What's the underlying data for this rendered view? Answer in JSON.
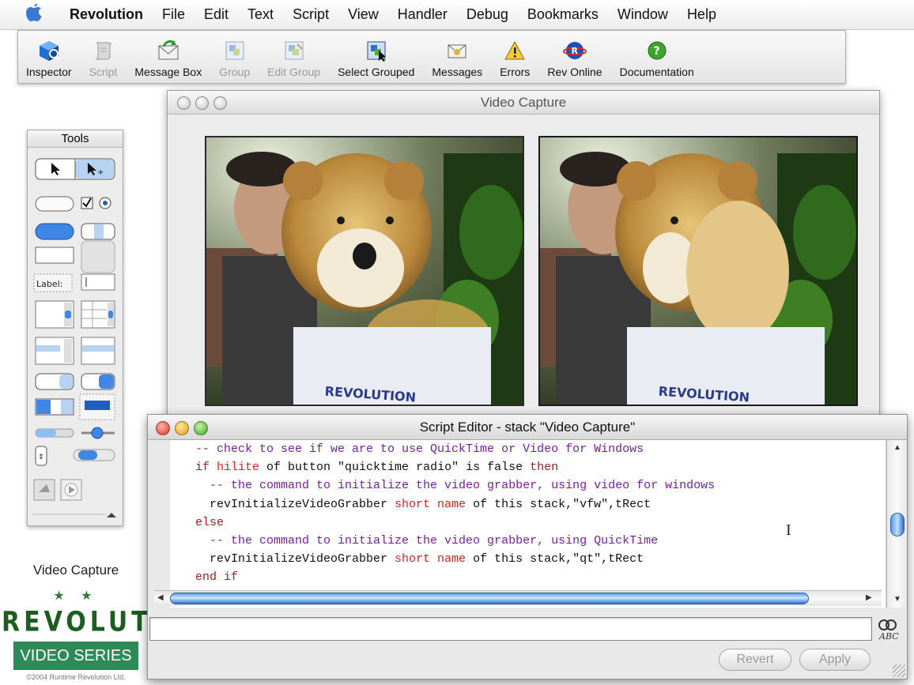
{
  "menubar": {
    "items": [
      "Revolution",
      "File",
      "Edit",
      "Text",
      "Script",
      "View",
      "Handler",
      "Debug",
      "Bookmarks",
      "Window",
      "Help"
    ]
  },
  "toolbar": {
    "buttons": [
      {
        "label": "Inspector",
        "enabled": true,
        "icon": "inspector-cube-icon"
      },
      {
        "label": "Script",
        "enabled": false,
        "icon": "script-scroll-icon"
      },
      {
        "label": "Message Box",
        "enabled": true,
        "icon": "envelope-icon"
      },
      {
        "label": "Group",
        "enabled": false,
        "icon": "group-icon"
      },
      {
        "label": "Edit Group",
        "enabled": false,
        "icon": "edit-group-icon"
      },
      {
        "label": "Select Grouped",
        "enabled": true,
        "icon": "select-grouped-icon"
      },
      {
        "label": "Messages",
        "enabled": true,
        "icon": "messages-icon"
      },
      {
        "label": "Errors",
        "enabled": true,
        "icon": "warning-icon"
      },
      {
        "label": "Rev Online",
        "enabled": true,
        "icon": "rev-online-icon"
      },
      {
        "label": "Documentation",
        "enabled": true,
        "icon": "help-icon"
      }
    ]
  },
  "tools_palette": {
    "title": "Tools",
    "label_tool_text": "Label:"
  },
  "video_window": {
    "title": "Video Capture"
  },
  "script_editor": {
    "title": "Script Editor - stack \"Video Capture\"",
    "code_lines": [
      [
        {
          "t": "-- check to see if we are to use QuickTime or Video for Windows",
          "c": "cm"
        }
      ],
      [
        {
          "t": "if ",
          "c": "kw"
        },
        {
          "t": "hilite",
          "c": "pr"
        },
        {
          "t": " of button \"quicktime radio\" is false ",
          "c": ""
        },
        {
          "t": "then",
          "c": "kw"
        }
      ],
      [
        {
          "t": "  -- the command to initialize the video grabber, using video for windows",
          "c": "cm"
        }
      ],
      [
        {
          "t": "  revInitializeVideoGrabber ",
          "c": ""
        },
        {
          "t": "short name",
          "c": "pr"
        },
        {
          "t": " of this stack,\"vfw\",tRect",
          "c": ""
        }
      ],
      [
        {
          "t": "else",
          "c": "kw"
        }
      ],
      [
        {
          "t": "  -- the command to initialize the video grabber, using QuickTime",
          "c": "cm"
        }
      ],
      [
        {
          "t": "  revInitializeVideoGrabber ",
          "c": ""
        },
        {
          "t": "short name",
          "c": "pr"
        },
        {
          "t": " of this stack,\"qt\",tRect",
          "c": ""
        }
      ],
      [
        {
          "t": "end if",
          "c": "kw"
        }
      ]
    ],
    "revert_label": "Revert",
    "apply_label": "Apply"
  },
  "branding": {
    "title": "Video Capture",
    "stars": "★ ★",
    "logo": "REVOLUTION",
    "series": "VIDEO SERIES",
    "copyright": "©2004 Runtime Revolution Ltd."
  },
  "colors": {
    "comment": "#7a1fa2",
    "keyword": "#a12020",
    "property": "#e0241c",
    "brand_green": "#2e8b57"
  }
}
